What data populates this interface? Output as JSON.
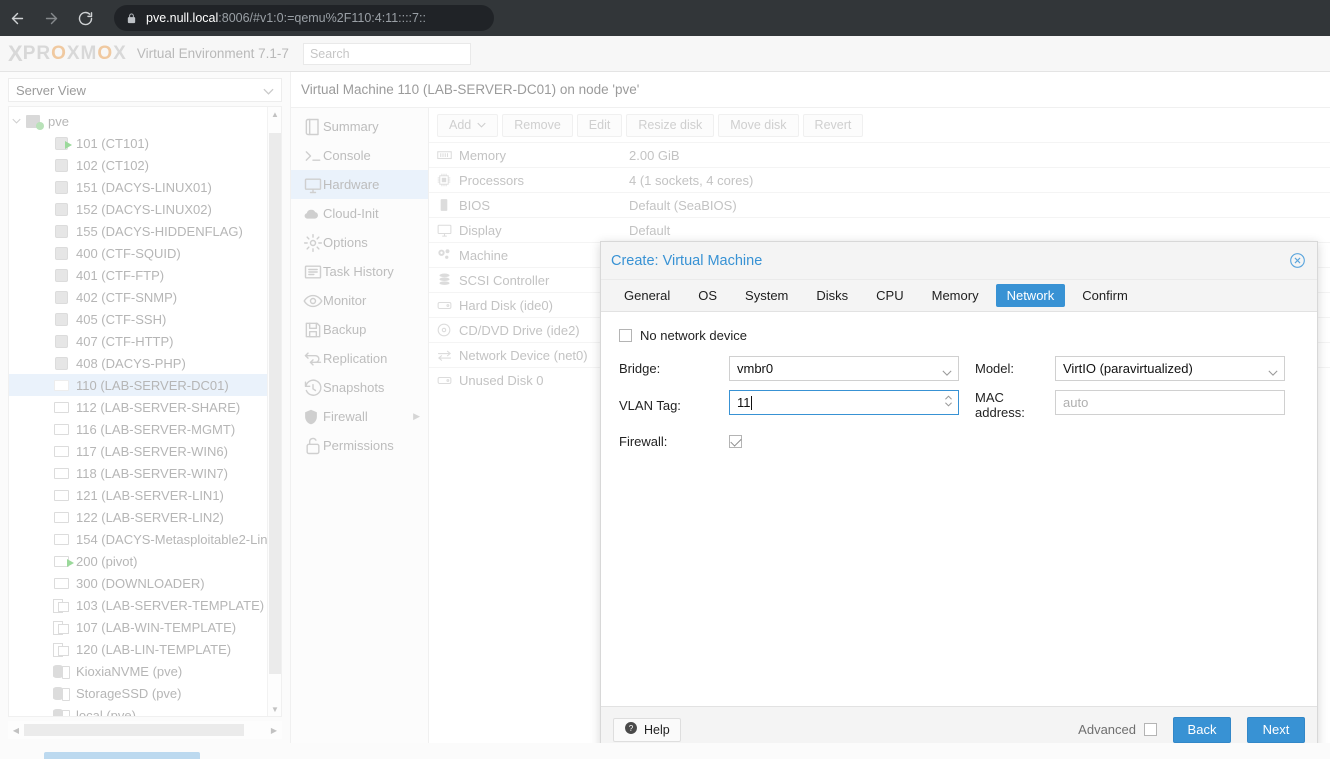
{
  "browser": {
    "back_icon": "back-arrow-icon",
    "forward_icon": "forward-arrow-icon",
    "reload_icon": "reload-icon",
    "lock_icon": "lock-icon",
    "url_host": "pve.null.local",
    "url_rest": ":8006/#v1:0:=qemu%2F110:4:11::::7::"
  },
  "appbar": {
    "logo_text": "PROXMOX",
    "product": "Virtual Environment 7.1-7",
    "search_placeholder": "Search"
  },
  "sidebar": {
    "view_selector": "Server View",
    "view_caret_icon": "chevron-down-icon",
    "scroll_up_icon": "scroll-up-arrow-icon",
    "scroll_down_icon": "scroll-down-arrow-icon",
    "scroll_left_icon": "scroll-left-arrow-icon",
    "scroll_right_icon": "scroll-right-arrow-icon",
    "tree": [
      {
        "label": "pve",
        "indent": 14,
        "icon": "server-node-icon",
        "caret": "chevron-down-icon",
        "selected": false
      },
      {
        "label": "101 (CT101)",
        "indent": 42,
        "icon": "container-running-icon",
        "selected": false
      },
      {
        "label": "102 (CT102)",
        "indent": 42,
        "icon": "container-icon",
        "selected": false
      },
      {
        "label": "151 (DACYS-LINUX01)",
        "indent": 42,
        "icon": "container-icon",
        "selected": false
      },
      {
        "label": "152 (DACYS-LINUX02)",
        "indent": 42,
        "icon": "container-icon",
        "selected": false
      },
      {
        "label": "155 (DACYS-HIDDENFLAG)",
        "indent": 42,
        "icon": "container-icon",
        "selected": false
      },
      {
        "label": "400 (CTF-SQUID)",
        "indent": 42,
        "icon": "container-icon",
        "selected": false
      },
      {
        "label": "401 (CTF-FTP)",
        "indent": 42,
        "icon": "container-icon",
        "selected": false
      },
      {
        "label": "402 (CTF-SNMP)",
        "indent": 42,
        "icon": "container-icon",
        "selected": false
      },
      {
        "label": "405 (CTF-SSH)",
        "indent": 42,
        "icon": "container-icon",
        "selected": false
      },
      {
        "label": "407 (CTF-HTTP)",
        "indent": 42,
        "icon": "container-icon",
        "selected": false
      },
      {
        "label": "408 (DACYS-PHP)",
        "indent": 42,
        "icon": "container-icon",
        "selected": false
      },
      {
        "label": "110 (LAB-SERVER-DC01)",
        "indent": 42,
        "icon": "vm-icon-pale",
        "selected": true
      },
      {
        "label": "112 (LAB-SERVER-SHARE)",
        "indent": 42,
        "icon": "vm-icon",
        "selected": false
      },
      {
        "label": "116 (LAB-SERVER-MGMT)",
        "indent": 42,
        "icon": "vm-icon",
        "selected": false
      },
      {
        "label": "117 (LAB-SERVER-WIN6)",
        "indent": 42,
        "icon": "vm-icon",
        "selected": false
      },
      {
        "label": "118 (LAB-SERVER-WIN7)",
        "indent": 42,
        "icon": "vm-icon",
        "selected": false
      },
      {
        "label": "121 (LAB-SERVER-LIN1)",
        "indent": 42,
        "icon": "vm-icon",
        "selected": false
      },
      {
        "label": "122 (LAB-SERVER-LIN2)",
        "indent": 42,
        "icon": "vm-icon",
        "selected": false
      },
      {
        "label": "154 (DACYS-Metasploitable2-Lin",
        "indent": 42,
        "icon": "vm-icon",
        "selected": false
      },
      {
        "label": "200 (pivot)",
        "indent": 42,
        "icon": "vm-running-icon",
        "selected": false
      },
      {
        "label": "300 (DOWNLOADER)",
        "indent": 42,
        "icon": "vm-icon",
        "selected": false
      },
      {
        "label": "103 (LAB-SERVER-TEMPLATE)",
        "indent": 42,
        "icon": "template-icon",
        "selected": false
      },
      {
        "label": "107 (LAB-WIN-TEMPLATE)",
        "indent": 42,
        "icon": "template-icon",
        "selected": false
      },
      {
        "label": "120 (LAB-LIN-TEMPLATE)",
        "indent": 42,
        "icon": "template-icon",
        "selected": false
      },
      {
        "label": "KioxiaNVME (pve)",
        "indent": 42,
        "icon": "storage-icon",
        "selected": false
      },
      {
        "label": "StorageSSD (pve)",
        "indent": 42,
        "icon": "storage-icon",
        "selected": false
      },
      {
        "label": "local (pve)",
        "indent": 42,
        "icon": "storage-icon",
        "selected": false
      }
    ]
  },
  "main": {
    "title": "Virtual Machine 110 (LAB-SERVER-DC01) on node 'pve'",
    "nav": [
      {
        "label": "Summary",
        "icon": "book-icon",
        "active": false,
        "submenu": false
      },
      {
        "label": "Console",
        "icon": "terminal-icon",
        "active": false,
        "submenu": false
      },
      {
        "label": "Hardware",
        "icon": "monitor-icon",
        "active": true,
        "submenu": false
      },
      {
        "label": "Cloud-Init",
        "icon": "cloud-icon",
        "active": false,
        "submenu": false
      },
      {
        "label": "Options",
        "icon": "gear-icon",
        "active": false,
        "submenu": false
      },
      {
        "label": "Task History",
        "icon": "list-icon",
        "active": false,
        "submenu": false
      },
      {
        "label": "Monitor",
        "icon": "eye-icon",
        "active": false,
        "submenu": false
      },
      {
        "label": "Backup",
        "icon": "floppy-icon",
        "active": false,
        "submenu": false
      },
      {
        "label": "Replication",
        "icon": "replication-icon",
        "active": false,
        "submenu": false
      },
      {
        "label": "Snapshots",
        "icon": "history-icon",
        "active": false,
        "submenu": false
      },
      {
        "label": "Firewall",
        "icon": "shield-icon",
        "active": false,
        "submenu": true
      },
      {
        "label": "Permissions",
        "icon": "unlock-icon",
        "active": false,
        "submenu": false
      }
    ],
    "toolbar": [
      {
        "label": "Add",
        "caret": true
      },
      {
        "label": "Remove",
        "caret": false
      },
      {
        "label": "Edit",
        "caret": false
      },
      {
        "label": "Resize disk",
        "caret": false
      },
      {
        "label": "Move disk",
        "caret": false
      },
      {
        "label": "Revert",
        "caret": false
      }
    ],
    "hardware_rows": [
      {
        "icon": "memory-icon",
        "key": "Memory",
        "value": "2.00 GiB"
      },
      {
        "icon": "cpu-icon",
        "key": "Processors",
        "value": "4 (1 sockets, 4 cores)"
      },
      {
        "icon": "bios-chip-icon",
        "key": "BIOS",
        "value": "Default (SeaBIOS)"
      },
      {
        "icon": "display-icon",
        "key": "Display",
        "value": "Default"
      },
      {
        "icon": "machine-cogs-icon",
        "key": "Machine",
        "value": ""
      },
      {
        "icon": "scsi-stack-icon",
        "key": "SCSI Controller",
        "value": ""
      },
      {
        "icon": "harddisk-icon",
        "key": "Hard Disk (ide0)",
        "value": ""
      },
      {
        "icon": "cd-disc-icon",
        "key": "CD/DVD Drive (ide2)",
        "value": ""
      },
      {
        "icon": "network-icon",
        "key": "Network Device (net0)",
        "value": ""
      },
      {
        "icon": "harddisk-icon",
        "key": "Unused Disk 0",
        "value": ""
      }
    ]
  },
  "dialog": {
    "title": "Create: Virtual Machine",
    "close_icon": "close-circle-icon",
    "tabs": [
      {
        "label": "General",
        "active": false
      },
      {
        "label": "OS",
        "active": false
      },
      {
        "label": "System",
        "active": false
      },
      {
        "label": "Disks",
        "active": false
      },
      {
        "label": "CPU",
        "active": false
      },
      {
        "label": "Memory",
        "active": false
      },
      {
        "label": "Network",
        "active": true
      },
      {
        "label": "Confirm",
        "active": false
      }
    ],
    "no_network_device": {
      "label": "No network device",
      "checked": false
    },
    "fields": {
      "bridge_label": "Bridge:",
      "bridge_value": "vmbr0",
      "vlan_label": "VLAN Tag:",
      "vlan_value": "11",
      "firewall_label": "Firewall:",
      "firewall_checked": true,
      "model_label": "Model:",
      "model_value": "VirtIO (paravirtualized)",
      "mac_label": "MAC address:",
      "mac_placeholder": "auto"
    },
    "footer": {
      "help_label": "Help",
      "help_icon": "question-circle-icon",
      "advanced_label": "Advanced",
      "advanced_checked": false,
      "back_label": "Back",
      "next_label": "Next"
    }
  },
  "colors": {
    "accent": "#3892d4",
    "browser_chrome": "#323639",
    "selection": "#eaf2fb"
  }
}
